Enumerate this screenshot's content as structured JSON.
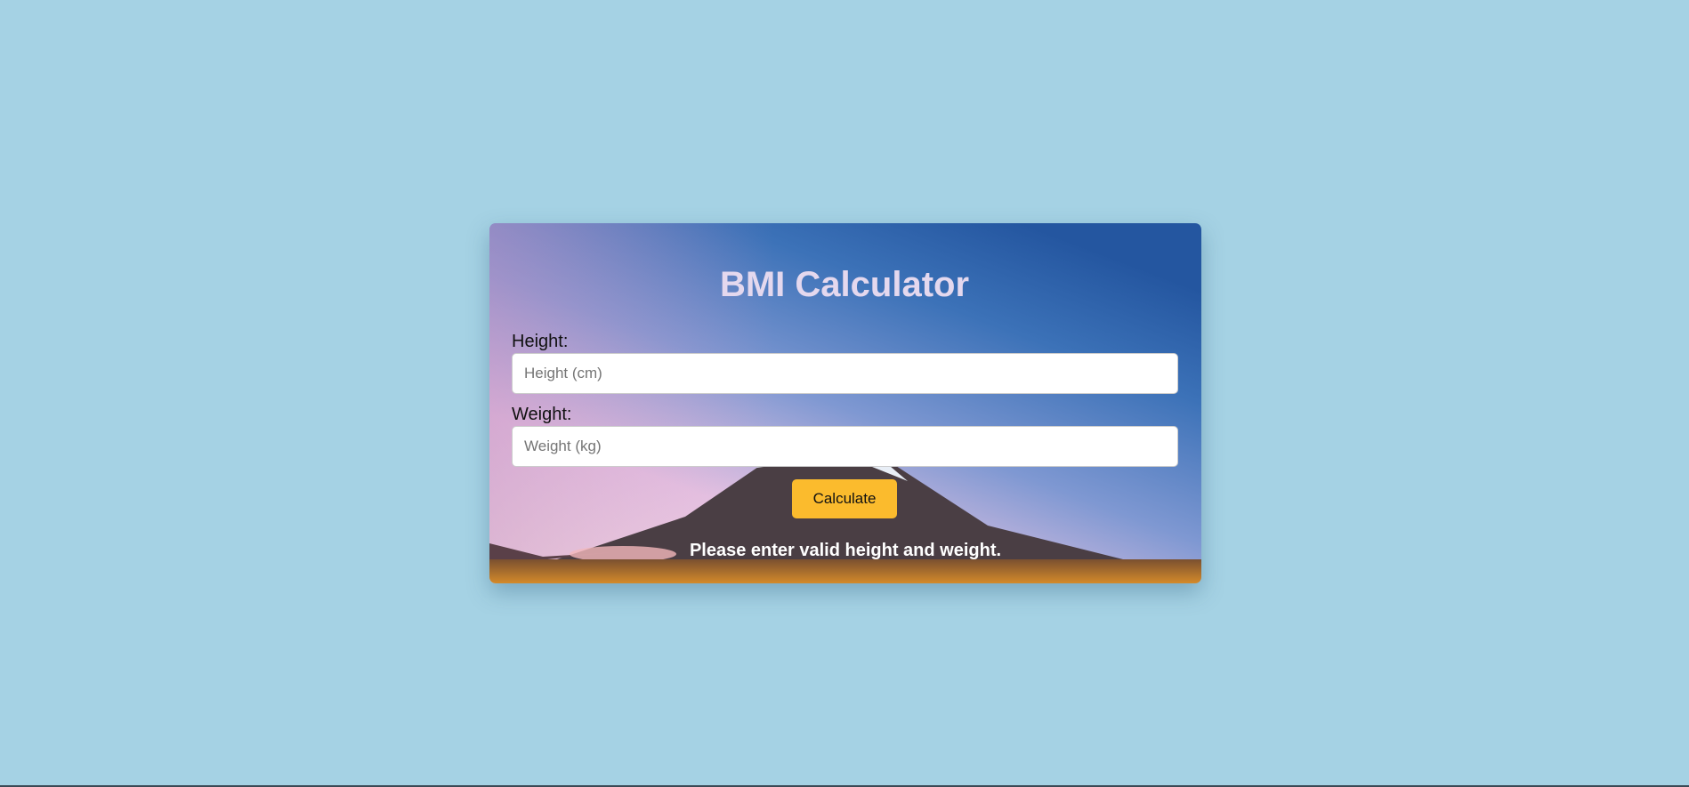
{
  "title": "BMI Calculator",
  "height": {
    "label": "Height:",
    "placeholder": "Height (cm)",
    "value": ""
  },
  "weight": {
    "label": "Weight:",
    "placeholder": "Weight (kg)",
    "value": ""
  },
  "calculate_label": "Calculate",
  "message": "Please enter valid height and weight.",
  "colors": {
    "page_bg": "#a5d2e4",
    "button": "#fbbb2d",
    "title": "#e4d8ee"
  }
}
